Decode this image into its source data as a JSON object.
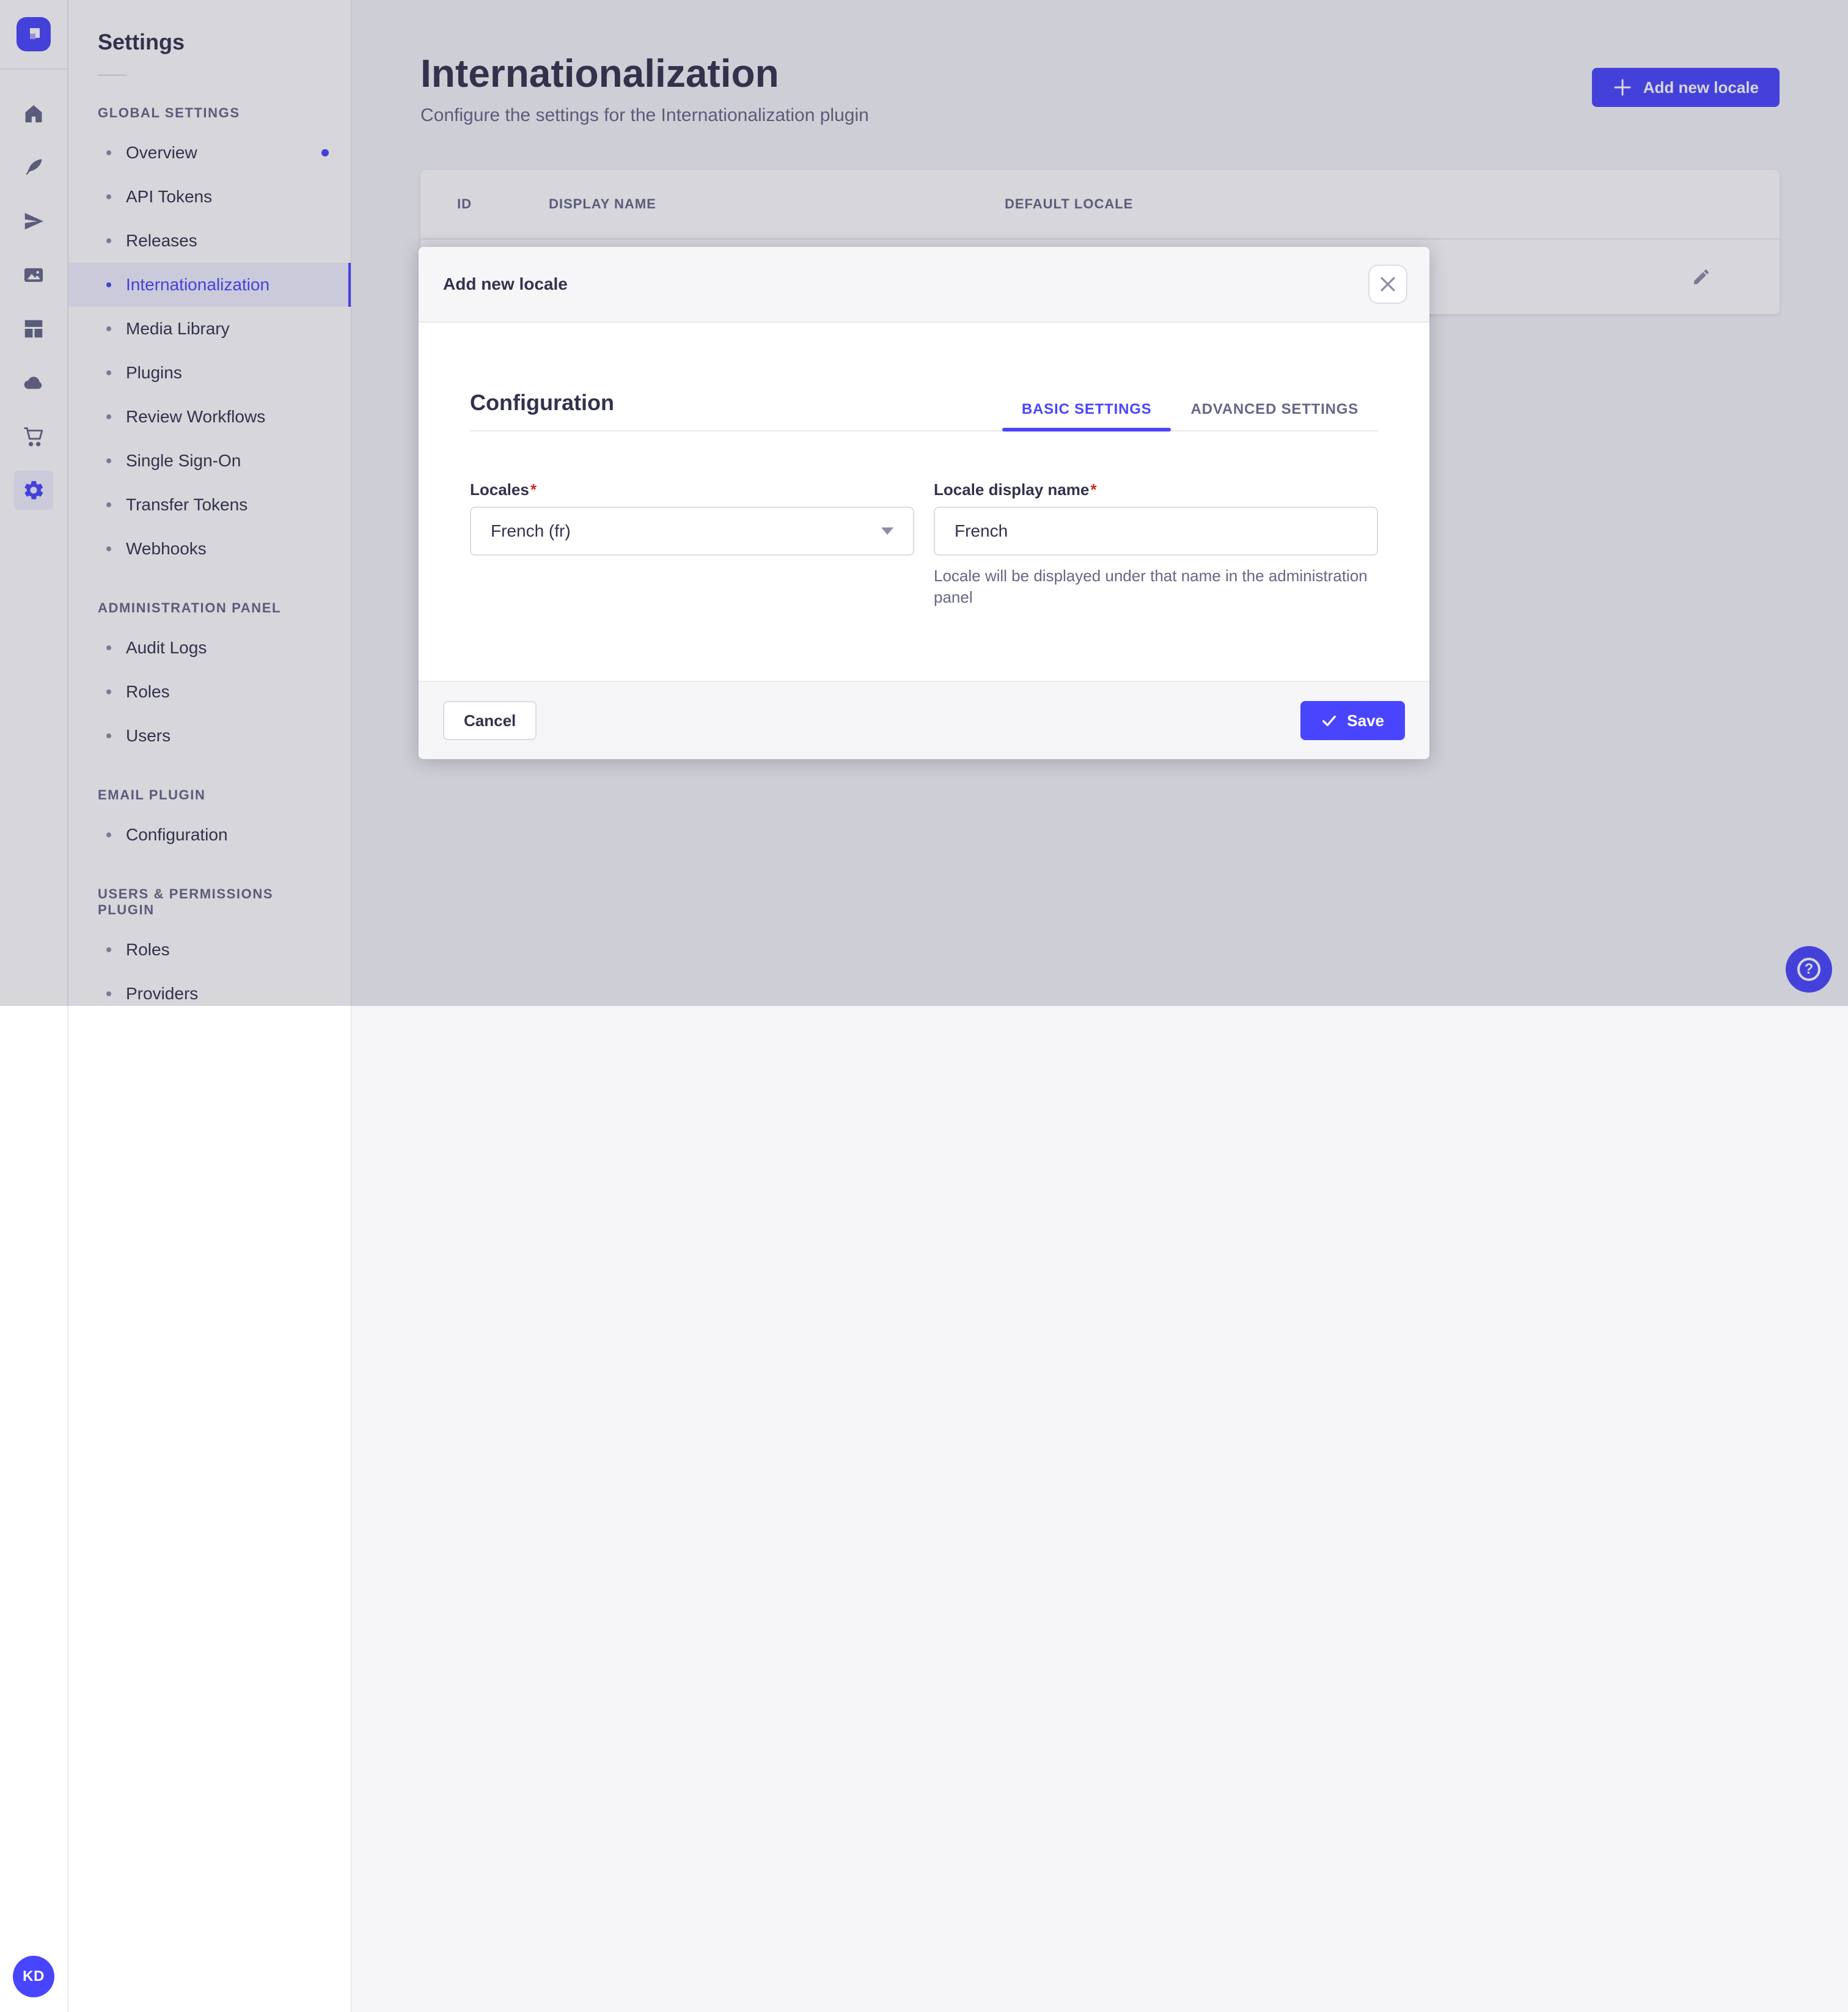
{
  "colors": {
    "primary": "#4945FF",
    "text": "#32324D",
    "muted": "#666687",
    "border": "#DCDCE4",
    "divider": "#EAEAEF",
    "active_bg": "#F0F0FF",
    "required": "#D02B20",
    "overlay": "rgba(50,50,77,0.2)"
  },
  "rail": {
    "logo_icon": "strapi-logo",
    "icons": [
      "home",
      "feather",
      "paper-plane",
      "media",
      "layout",
      "cloud",
      "cart",
      "gear"
    ],
    "active_icon": "gear",
    "avatar_initials": "KD"
  },
  "sidebar": {
    "title": "Settings",
    "sections": [
      {
        "label": "GLOBAL SETTINGS",
        "items": [
          {
            "label": "Overview",
            "notification": true
          },
          {
            "label": "API Tokens"
          },
          {
            "label": "Releases"
          },
          {
            "label": "Internationalization",
            "active": true
          },
          {
            "label": "Media Library"
          },
          {
            "label": "Plugins"
          },
          {
            "label": "Review Workflows"
          },
          {
            "label": "Single Sign-On"
          },
          {
            "label": "Transfer Tokens"
          },
          {
            "label": "Webhooks"
          }
        ]
      },
      {
        "label": "ADMINISTRATION PANEL",
        "items": [
          {
            "label": "Audit Logs"
          },
          {
            "label": "Roles"
          },
          {
            "label": "Users"
          }
        ]
      },
      {
        "label": "EMAIL PLUGIN",
        "items": [
          {
            "label": "Configuration"
          }
        ]
      },
      {
        "label": "USERS & PERMISSIONS PLUGIN",
        "items": [
          {
            "label": "Roles"
          },
          {
            "label": "Providers"
          }
        ]
      }
    ]
  },
  "header": {
    "title": "Internationalization",
    "subtitle": "Configure the settings for the Internationalization plugin",
    "add_button_label": "Add new locale"
  },
  "table": {
    "columns": [
      "ID",
      "DISPLAY NAME",
      "DEFAULT LOCALE"
    ],
    "row_action_icon": "pencil"
  },
  "modal": {
    "title": "Add new locale",
    "close_icon": "close",
    "section_title": "Configuration",
    "tabs": [
      {
        "label": "BASIC SETTINGS",
        "active": true
      },
      {
        "label": "ADVANCED SETTINGS",
        "active": false
      }
    ],
    "fields": {
      "locales": {
        "label": "Locales",
        "asterisk": "*",
        "value": "French (fr)"
      },
      "display_name": {
        "label": "Locale display name",
        "asterisk": "*",
        "value": "French",
        "hint": "Locale will be displayed under that name in the administration panel"
      }
    },
    "footer": {
      "cancel_label": "Cancel",
      "save_label": "Save"
    }
  },
  "help": {
    "glyph": "?"
  }
}
